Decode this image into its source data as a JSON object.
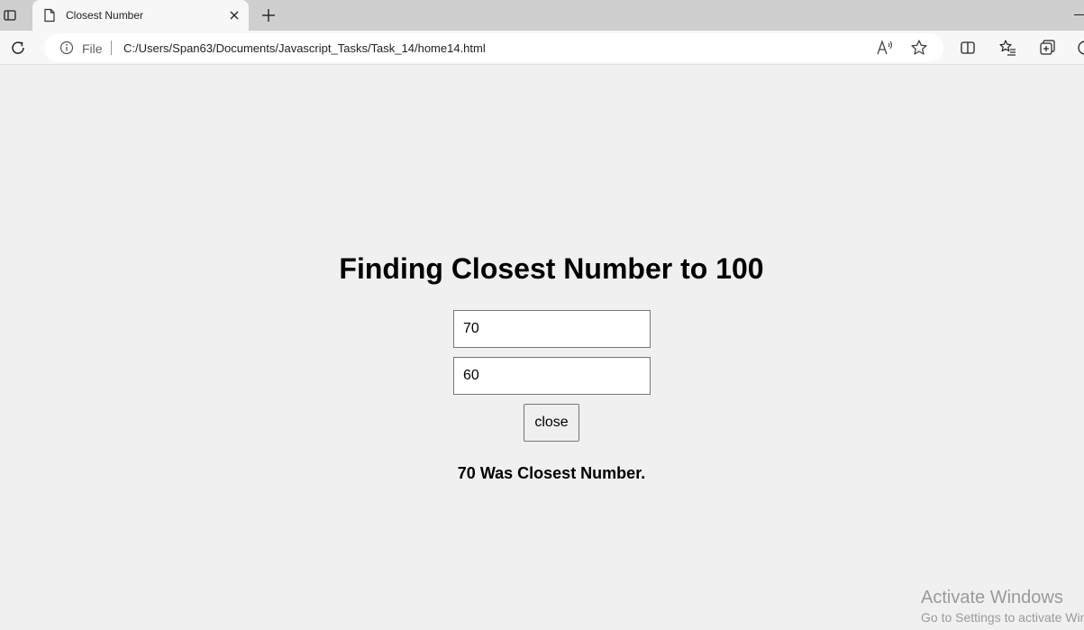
{
  "browser": {
    "tab": {
      "title": "Closest Number"
    },
    "address_bar": {
      "scheme_label": "File",
      "url": "C:/Users/Span63/Documents/Javascript_Tasks/Task_14/home14.html"
    },
    "icons": [
      "tab-actions-icon",
      "page-icon",
      "close-icon",
      "plus-icon",
      "refresh-icon",
      "info-icon",
      "read-aloud-icon",
      "star-icon",
      "split-screen-icon",
      "favorites-icon",
      "collections-icon",
      "copilot-icon"
    ]
  },
  "page": {
    "heading": "Finding Closest Number to 100",
    "inputs": [
      {
        "value": "70"
      },
      {
        "value": "60"
      }
    ],
    "button_label": "close",
    "result": "70 Was Closest Number."
  },
  "watermark": {
    "title": "Activate Windows",
    "subtitle": "Go to Settings to activate Windows."
  }
}
